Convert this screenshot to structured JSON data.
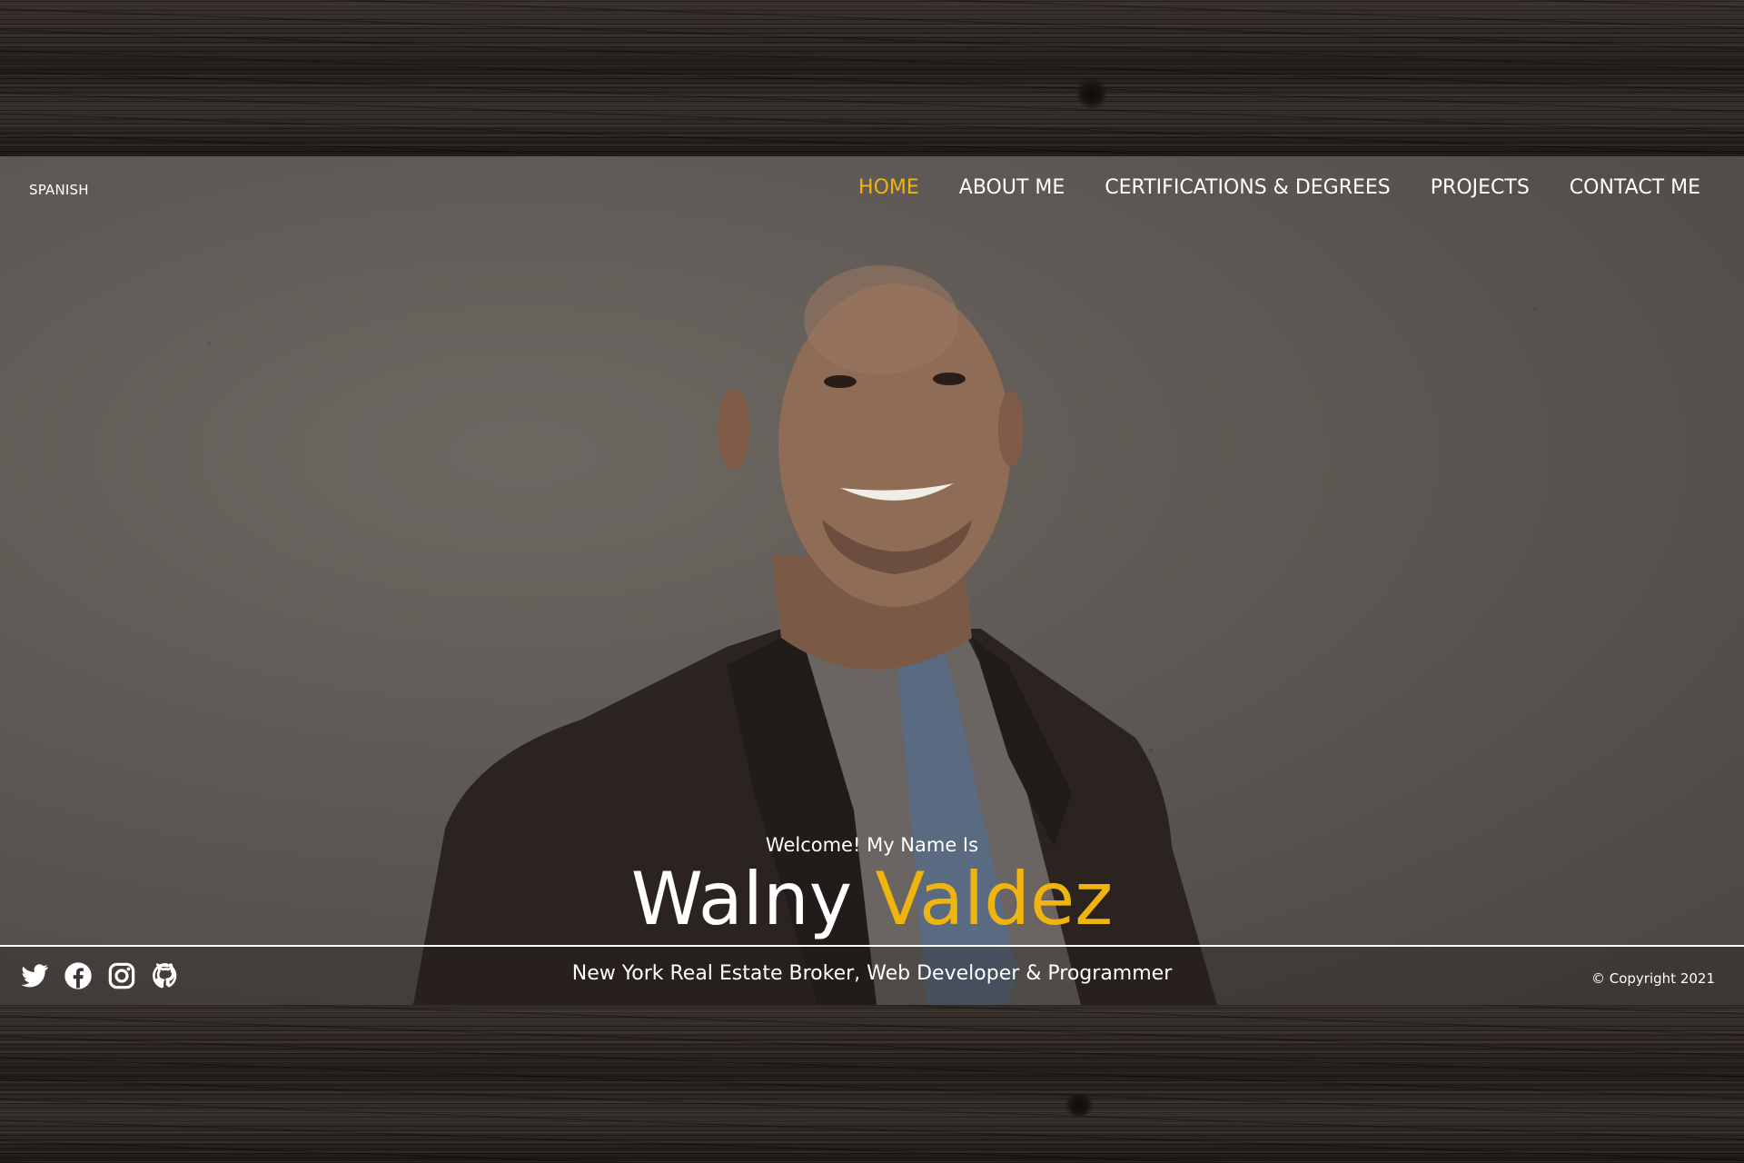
{
  "nav": {
    "language_toggle": "SPANISH",
    "items": [
      {
        "label": "HOME",
        "active": true
      },
      {
        "label": "ABOUT ME",
        "active": false
      },
      {
        "label": "CERTIFICATIONS & DEGREES",
        "active": false
      },
      {
        "label": "PROJECTS",
        "active": false
      },
      {
        "label": "CONTACT ME",
        "active": false
      }
    ]
  },
  "hero": {
    "welcome": "Welcome! My Name Is",
    "first_name": "Walny",
    "last_name": "Valdez",
    "portrait_subject": "man-in-suit-portrait"
  },
  "footer": {
    "social_icons": [
      "twitter-icon",
      "facebook-icon",
      "instagram-icon",
      "github-icon"
    ],
    "tagline": "New York Real Estate Broker, Web Developer & Programmer",
    "copyright": "© Copyright 2021"
  },
  "colors": {
    "accent": "#f0b40f",
    "text": "#ffffff",
    "wood": "#2b2420",
    "backdrop": "#5d5853"
  }
}
